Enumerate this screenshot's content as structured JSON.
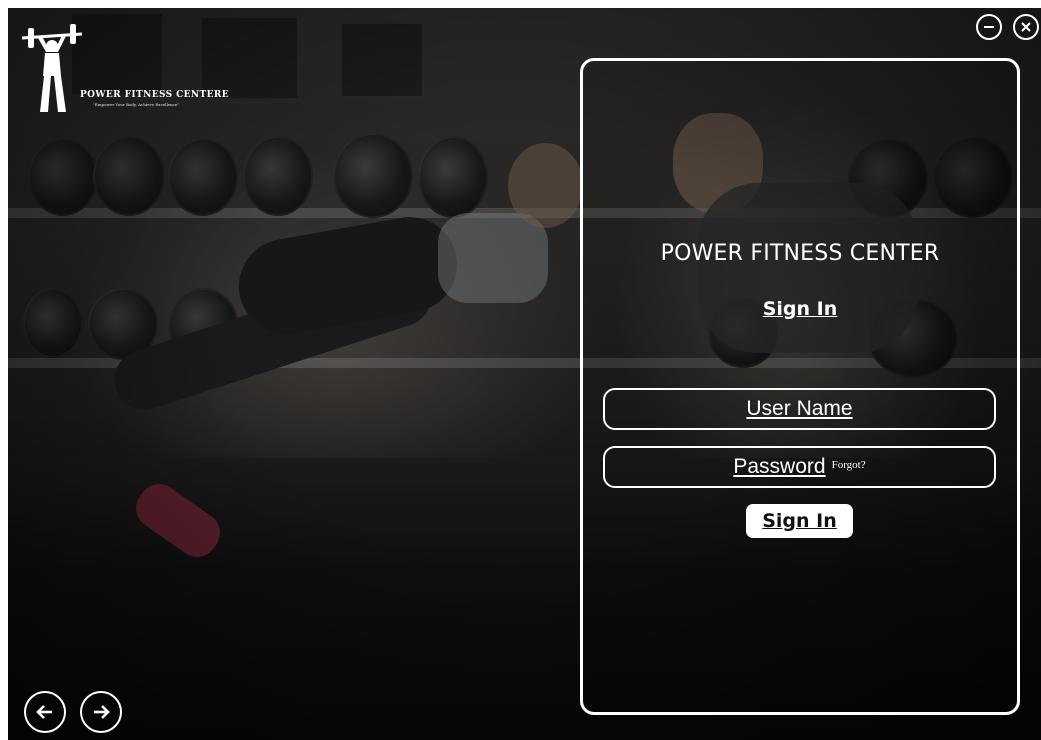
{
  "brand": {
    "name": "POWER FITNESS CENTERE",
    "tagline": "\"Empower Your Body, Achieve Excellence\""
  },
  "window_controls": {
    "minimize_icon": "minus-circle-icon",
    "close_icon": "x-circle-icon"
  },
  "login": {
    "title": "POWER FITNESS CENTER",
    "heading": "Sign In",
    "username_label": "User Name",
    "password_label": "Password",
    "forgot_label": "Forgot?",
    "submit_label": "Sign In"
  },
  "navigation": {
    "back_icon": "arrow-left-icon",
    "forward_icon": "arrow-right-icon"
  },
  "colors": {
    "foreground": "#ffffff",
    "button_text": "#111111",
    "background": "#1a1a1a"
  }
}
